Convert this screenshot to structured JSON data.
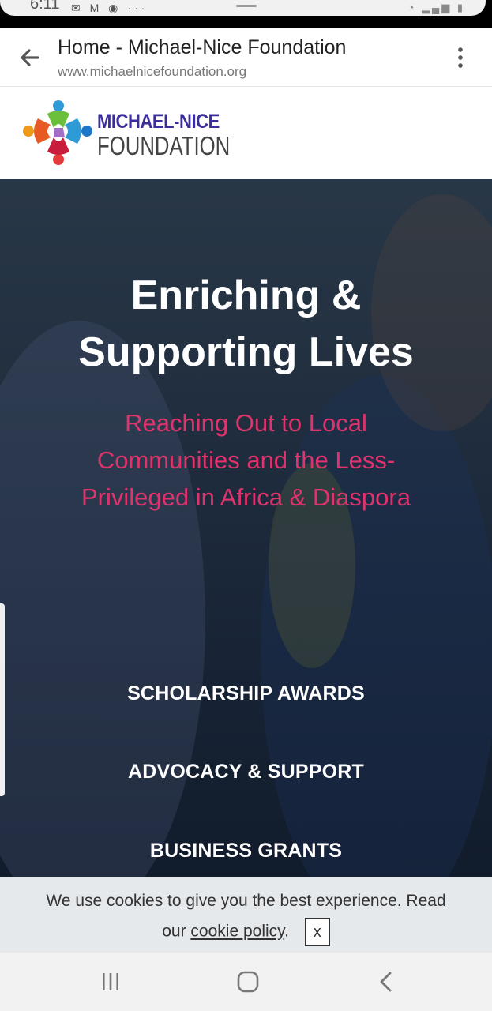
{
  "status_bar": {
    "time": "6:11"
  },
  "browser": {
    "page_title": "Home - Michael-Nice Foundation",
    "url": "www.michaelnicefoundation.org"
  },
  "logo": {
    "line1": "MICHAEL-NICE",
    "line2": "FOUNDATION"
  },
  "hero": {
    "title_line1": "Enriching &",
    "title_line2": "Supporting Lives",
    "subtitle": "Reaching Out to Local Communities and the Less-Privileged in Africa & Diaspora",
    "links": [
      "SCHOLARSHIP AWARDS",
      "ADVOCACY & SUPPORT",
      "BUSINESS GRANTS"
    ]
  },
  "cookie_bar": {
    "text_before": "We use cookies to give you the best experience. Read",
    "text_our": "our",
    "link": "cookie policy",
    "period": ".",
    "close_label": "x"
  },
  "colors": {
    "accent_pink": "#e0336d",
    "logo_purple": "#3a2f9a"
  },
  "icons": [
    "back-arrow-icon",
    "more-vert-icon",
    "recent-apps-icon",
    "home-icon",
    "back-icon"
  ]
}
